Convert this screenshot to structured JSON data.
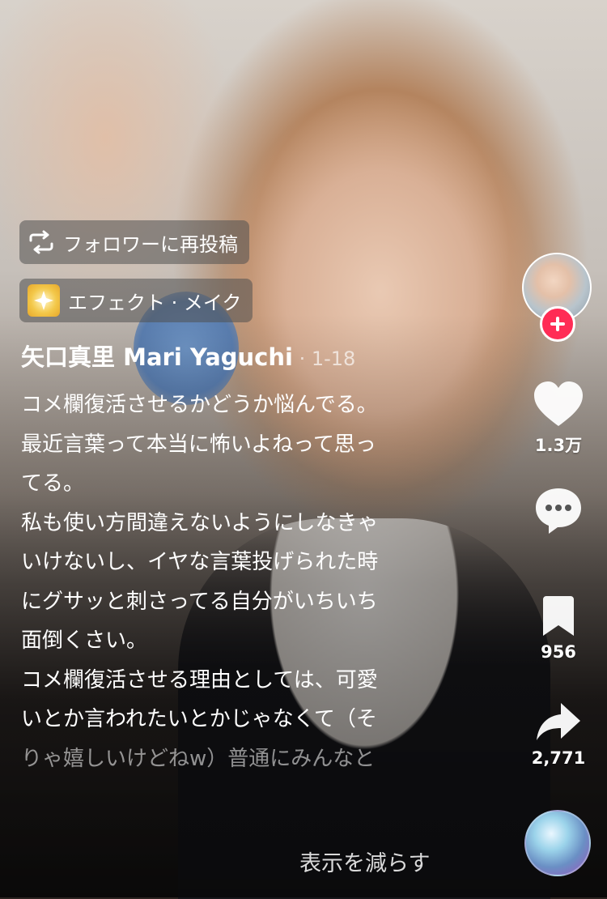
{
  "chips": {
    "repost_label": "フォロワーに再投稿",
    "effect_label": "エフェクト · メイク"
  },
  "author": {
    "name": "矢口真里 Mari Yaguchi",
    "date": " · 1-18"
  },
  "caption": {
    "lines": [
      "コメ欄復活させるかどうか悩んでる。",
      "最近言葉って本当に怖いよねって思っ",
      "てる。",
      "私も使い方間違えないようにしなきゃ",
      "いけないし、イヤな言葉投げられた時",
      "にグサッと刺さってる自分がいちいち",
      "面倒くさい。",
      "コメ欄復活させる理由としては、可愛",
      "いとか言われたいとかじゃなくて（そ",
      "りゃ嬉しいけどねw）普通にみんなと"
    ],
    "show_less": "表示を減らす"
  },
  "rail": {
    "like_count": "1.3万",
    "save_count": "956",
    "share_count": "2,771"
  },
  "colors": {
    "follow_accent": "#ff2c55",
    "text": "#ffffff"
  },
  "icons": [
    "repost-icon",
    "effect-icon",
    "avatar",
    "follow-plus-icon",
    "heart-icon",
    "comment-icon",
    "bookmark-icon",
    "share-icon",
    "sound-disc"
  ]
}
